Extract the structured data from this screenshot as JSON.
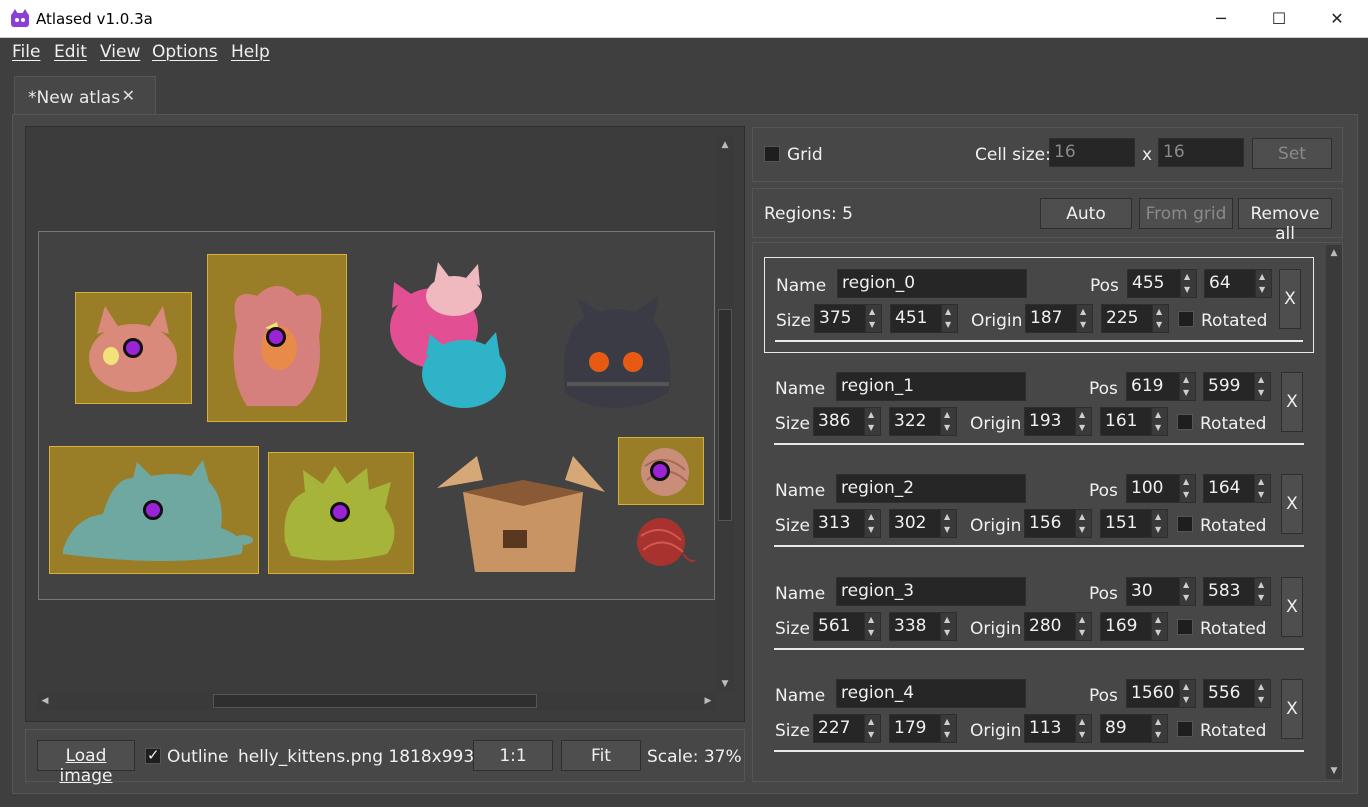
{
  "window": {
    "title": "Atlased v1.0.3a",
    "minimize": "─",
    "maximize": "☐",
    "close": "✕"
  },
  "menu": [
    "File",
    "Edit",
    "View",
    "Options",
    "Help"
  ],
  "tab": {
    "label": "*New atlas",
    "close": "✕"
  },
  "bottom": {
    "load_image": "Load image",
    "outline_label": "Outline",
    "outline_checked": true,
    "file_info": "helly_kittens.png 1818x993",
    "zoom_1_1": "1:1",
    "fit": "Fit",
    "scale": "Scale: 37%"
  },
  "grid": {
    "label": "Grid",
    "checked": false,
    "cell_size_label": "Cell size:",
    "cell_w": "16",
    "x_label": "x",
    "cell_h": "16",
    "set": "Set"
  },
  "regions_header": {
    "count_label": "Regions: 5",
    "auto": "Auto",
    "from_grid": "From grid",
    "remove_all": "Remove all"
  },
  "field_labels": {
    "name": "Name",
    "pos": "Pos",
    "size": "Size",
    "origin": "Origin",
    "rotated": "Rotated",
    "remove": "X"
  },
  "regions": [
    {
      "name": "region_0",
      "pos_x": "455",
      "pos_y": "64",
      "size_w": "375",
      "size_h": "451",
      "origin_x": "187",
      "origin_y": "225",
      "rotated": false,
      "selected": true
    },
    {
      "name": "region_1",
      "pos_x": "619",
      "pos_y": "599",
      "size_w": "386",
      "size_h": "322",
      "origin_x": "193",
      "origin_y": "161",
      "rotated": false,
      "selected": false
    },
    {
      "name": "region_2",
      "pos_x": "100",
      "pos_y": "164",
      "size_w": "313",
      "size_h": "302",
      "origin_x": "156",
      "origin_y": "151",
      "rotated": false,
      "selected": false
    },
    {
      "name": "region_3",
      "pos_x": "30",
      "pos_y": "583",
      "size_w": "561",
      "size_h": "338",
      "origin_x": "280",
      "origin_y": "169",
      "rotated": false,
      "selected": false
    },
    {
      "name": "region_4",
      "pos_x": "1560",
      "pos_y": "556",
      "size_w": "227",
      "size_h": "179",
      "origin_x": "113",
      "origin_y": "89",
      "rotated": false,
      "selected": false
    }
  ],
  "colors": {
    "region_fill": "#c99c18",
    "origin_dot": "#9a23d6",
    "background": "#3f3f3f"
  }
}
